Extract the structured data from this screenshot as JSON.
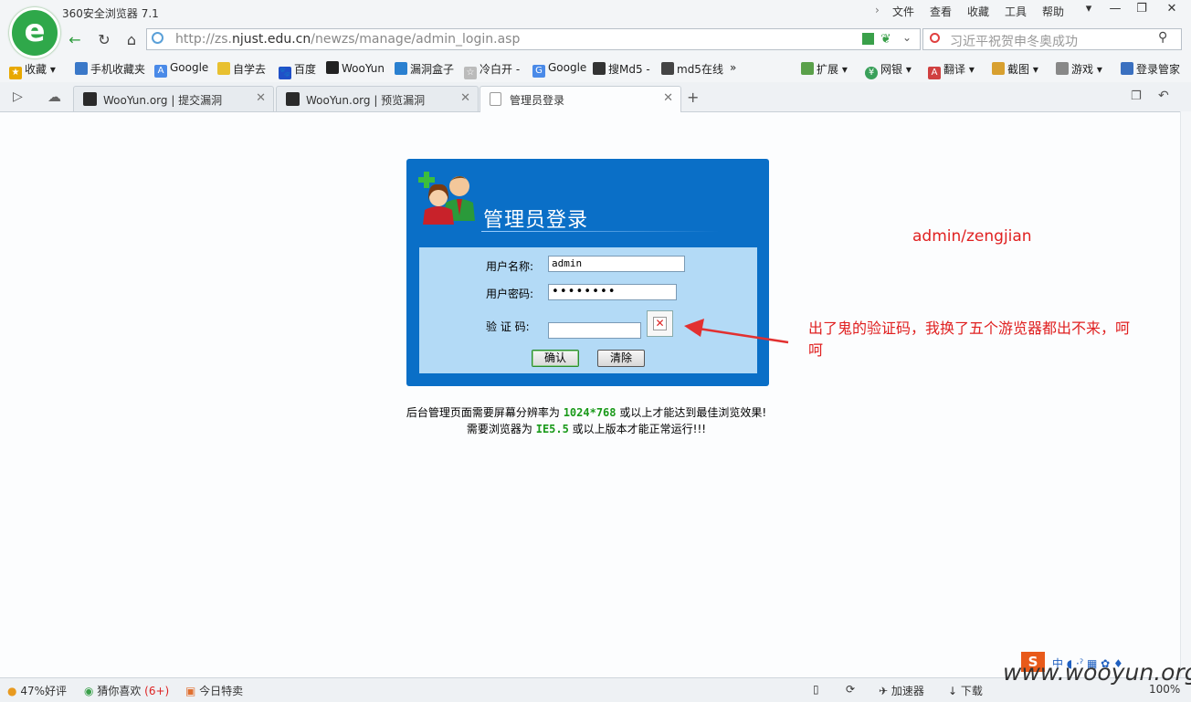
{
  "browser": {
    "title": "360安全浏览器 7.1",
    "menu": [
      "文件",
      "查看",
      "收藏",
      "工具",
      "帮助"
    ],
    "url_prefix": "http://zs.",
    "url_domain": "njust.edu.cn",
    "url_path": "/newzs/manage/admin_login.asp",
    "search_text": "习近平祝贺申冬奥成功"
  },
  "bookmarks": [
    "收藏",
    "手机收藏夹",
    "Google",
    "自学去",
    "百度",
    "WooYun",
    "漏洞盒子",
    "冷白开 -",
    "Google",
    "搜Md5 -",
    "md5在线",
    "»"
  ],
  "toolbar_right": [
    "扩展",
    "网银",
    "翻译",
    "截图",
    "游戏",
    "登录管家"
  ],
  "tabs": [
    {
      "label": "WooYun.org | 提交漏洞"
    },
    {
      "label": "WooYun.org | 预览漏洞"
    },
    {
      "label": "管理员登录"
    }
  ],
  "login": {
    "title": "管理员登录",
    "username_label": "用户名称:",
    "username_value": "admin",
    "password_label": "用户密码:",
    "password_value": "••••••••",
    "captcha_label": "验 证 码:",
    "captcha_value": "",
    "confirm_label": "确认",
    "clear_label": "清除"
  },
  "notes": {
    "line1_pre": "后台管理页面需要屏幕分辨率为",
    "line1_res": "1024*768",
    "line1_post": "或以上才能达到最佳浏览效果!",
    "line2_pre": "需要浏览器为",
    "line2_ver": "IE5.5",
    "line2_post": "或以上版本才能正常运行!!!"
  },
  "annotations": {
    "credentials": "admin/zengjian",
    "captcha_note": "出了鬼的验证码，我换了五个游览器都出不来，呵呵"
  },
  "status": {
    "rating": "47%好评",
    "guess": "猜你喜欢",
    "guess_count": "(6+)",
    "today": "今日特卖",
    "accelerator": "加速器",
    "download": "下载",
    "zoom": "100%",
    "watermark": "www.wooyun.org"
  },
  "colors": {
    "panel_blue": "#0a6fc7",
    "panel_inner": "#b3daf6",
    "annotation_red": "#e02020",
    "note_green": "#1a9a1a"
  }
}
